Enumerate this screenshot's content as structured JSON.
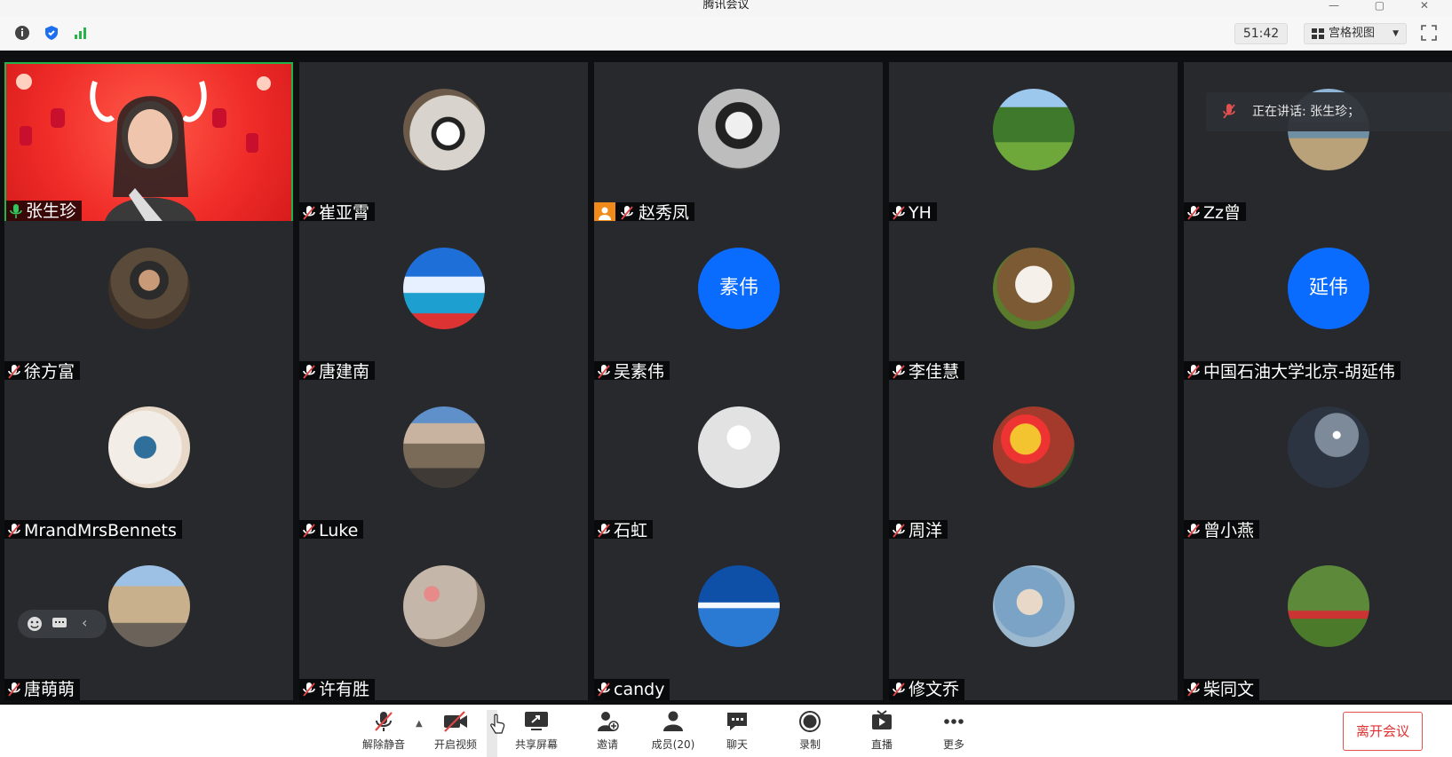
{
  "window": {
    "title": "腾讯会议",
    "controls": "— ▢ ✕"
  },
  "topbar": {
    "timer": "51:42",
    "view_mode": "宫格视图",
    "icons": [
      "info-icon",
      "shield-icon",
      "signal-icon",
      "grid-icon",
      "fullscreen-icon"
    ]
  },
  "speaking": {
    "text": "正在讲话: 张生珍；"
  },
  "participants": [
    {
      "name": "张生珍",
      "avatar": "video",
      "mic": "on",
      "host": false
    },
    {
      "name": "崔亚霄",
      "avatar": "coffee-photo",
      "mic": "muted",
      "host": false
    },
    {
      "name": "赵秀凤",
      "avatar": "portrait-photo",
      "mic": "muted",
      "host": true
    },
    {
      "name": "YH",
      "avatar": "tree-photo",
      "mic": "muted",
      "host": false
    },
    {
      "name": "Zz曾",
      "avatar": "coast-photo",
      "mic": "muted",
      "host": false
    },
    {
      "name": "徐方富",
      "avatar": "man-photo",
      "mic": "muted",
      "host": false
    },
    {
      "name": "唐建南",
      "avatar": "sky-photo",
      "mic": "muted",
      "host": false
    },
    {
      "name": "吴素伟",
      "avatar": "text",
      "avatar_text": "素伟",
      "mic": "muted",
      "host": false
    },
    {
      "name": "李佳慧",
      "avatar": "dog-photo",
      "mic": "muted",
      "host": false
    },
    {
      "name": "中国石油大学北京-胡延伟",
      "avatar": "text",
      "avatar_text": "延伟",
      "mic": "muted",
      "host": false
    },
    {
      "name": "MrandMrsBennets",
      "avatar": "reading-photo",
      "mic": "muted",
      "host": false
    },
    {
      "name": "Luke",
      "avatar": "canyon-photo",
      "mic": "muted",
      "host": false
    },
    {
      "name": "石虹",
      "avatar": "default",
      "mic": "muted",
      "host": false
    },
    {
      "name": "周洋",
      "avatar": "balloon-photo",
      "mic": "muted",
      "host": false
    },
    {
      "name": "曾小燕",
      "avatar": "night-photo",
      "mic": "muted",
      "host": false
    },
    {
      "name": "唐萌萌",
      "avatar": "colosseum-photo",
      "mic": "muted",
      "host": false
    },
    {
      "name": "许有胜",
      "avatar": "blossom-photo",
      "mic": "muted",
      "host": false
    },
    {
      "name": "candy",
      "avatar": "lake-photo",
      "mic": "muted",
      "host": false
    },
    {
      "name": "修文乔",
      "avatar": "couple-photo",
      "mic": "muted",
      "host": false
    },
    {
      "name": "柴同文",
      "avatar": "martial-photo",
      "mic": "muted",
      "host": false
    }
  ],
  "toolbar": {
    "unmute": "解除静音",
    "video": "开启视频",
    "share": "共享屏幕",
    "invite": "邀请",
    "members": "成员(20)",
    "chat": "聊天",
    "record": "录制",
    "live": "直播",
    "more": "更多",
    "leave": "离开会议"
  },
  "colors": {
    "accent": "#0a6cff",
    "active_border": "#23b34a",
    "leave": "#e03030",
    "tile_bg": "#27292d"
  }
}
